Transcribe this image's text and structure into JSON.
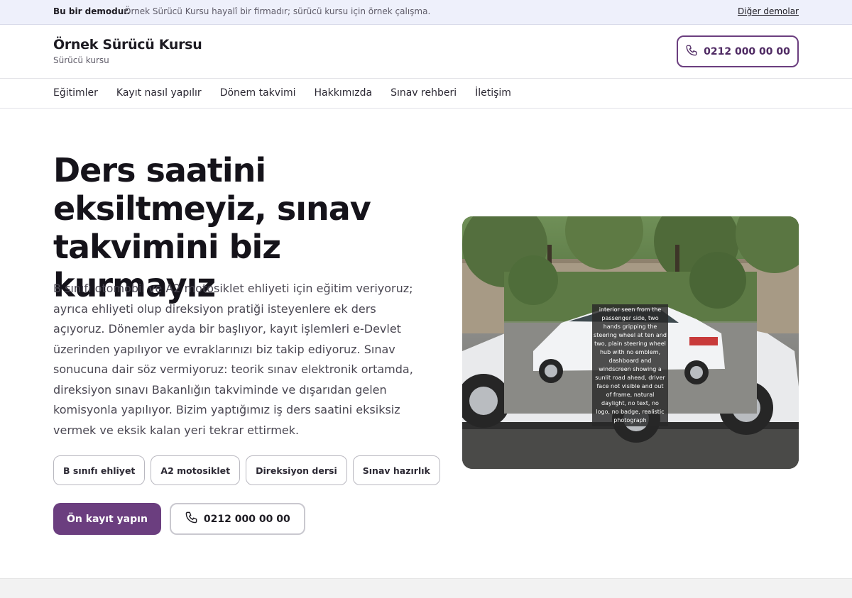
{
  "demo_bar": {
    "label": "Bu bir demodur.",
    "text": "Örnek Sürücü Kursu hayalî bir firmadır; sürücü kursu için örnek çalışma.",
    "link": "Diğer demolar"
  },
  "header": {
    "brand_title": "Örnek Sürücü Kursu",
    "brand_subtitle": "Sürücü kursu",
    "phone": "0212 000 00 00",
    "phone_icon": "phone-icon"
  },
  "nav": {
    "items": [
      "Eğitimler",
      "Kayıt nasıl yapılır",
      "Dönem takvimi",
      "Hakkımızda",
      "Sınav rehberi",
      "İletişim"
    ]
  },
  "hero": {
    "title": "Ders saatini eksiltmeyiz, sınav takvimini biz kurmayız",
    "text": "B sınıfı otomobil ve A2 motosiklet ehliyeti için eğitim veriyoruz; ayrıca ehliyeti olup direksiyon pratiği isteyenlere ek ders açıyoruz. Dönemler ayda bir başlıyor, kayıt işlemleri e-Devlet üzerinden yapılıyor ve evraklarınızı biz takip ediyoruz. Sınav sonucuna dair söz vermiyoruz: teorik sınav elektronik ortamda, direksiyon sınavı Bakanlığın takviminde ve dışarıdan gelen komisyonla yapılıyor. Bizim yaptığımız iş ders saatini eksiksiz vermek ve eksik kalan yeri tekrar ettirmek.",
    "chips": [
      "B sınıfı ehliyet",
      "A2 motosiklet",
      "Direksiyon dersi",
      "Sınav hazırlık"
    ],
    "primary_cta": "Ön kayıt yapın",
    "secondary_cta": "0212 000 00 00",
    "image_caption": "interior seen from the passenger side, two hands gripping the steering wheel at ten and two, plain steering wheel hub with no emblem, dashboard and windscreen showing a sunlit road ahead, driver face not visible and out of frame, natural daylight, no text, no logo, no badge, realistic photograph"
  },
  "colors": {
    "accent": "#6b3e7f",
    "demo_bar_bg": "#eef0fb"
  }
}
